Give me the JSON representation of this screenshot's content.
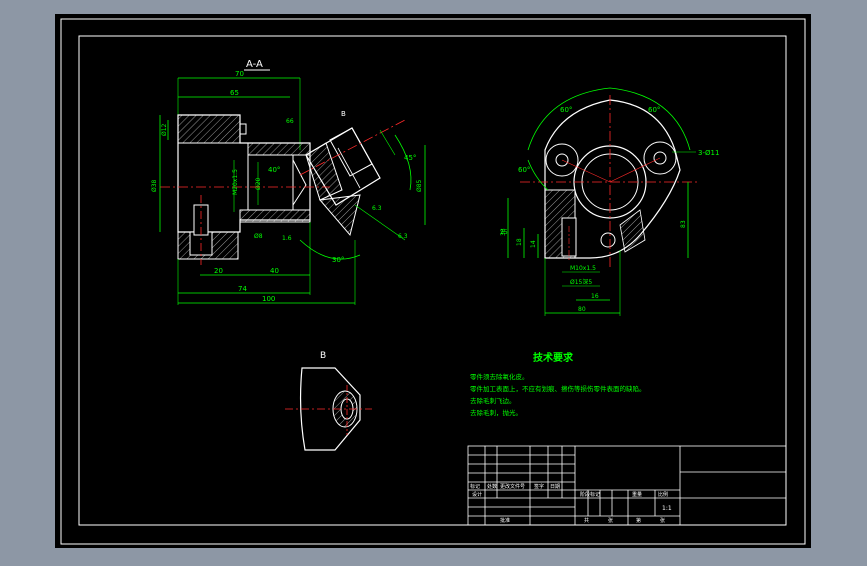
{
  "colors": {
    "frame_bg": "#8d97a5",
    "model_bg": "#000000",
    "outline": "#ffffff",
    "dimension": "#00ff00",
    "hatch": "#ffffff",
    "centerline": "#ff2a2a",
    "title_text": "#ffffff"
  },
  "section_label": "A-A",
  "detail_label": "B",
  "right_view_label_b": "B",
  "dimensions": {
    "top_overall": "70",
    "top_second": "65",
    "left_dia": "Ø38",
    "left_small": "Ø12",
    "bottom_20": "20",
    "bottom_40": "40",
    "bottom_74": "74",
    "bottom_100": "100",
    "bore_m": "M20x1.5",
    "bore_depth": "Ø20",
    "angle_40": "40°",
    "angle_30": "30°",
    "angle_45": "45°",
    "depth_66": "66",
    "right_dia": "Ø85",
    "chamfer_1": "1.6",
    "chamfer_2": "6.3",
    "right_view_angle_left": "60°",
    "right_view_angle_right": "60°",
    "right_view_angle_lower": "60°",
    "holes": "3-Ø11",
    "rv_height": "83",
    "rv_38": "38",
    "rv_18": "18",
    "rv_14": "14",
    "rv_m": "M10x1.5",
    "rv_16": "16",
    "rv_80": "80",
    "rv_counterbore": "Ø15深5",
    "rv_25": "25",
    "small_dim_a": "Ø8",
    "small_dim_b": "6.3"
  },
  "tech_req": {
    "title": "技术要求",
    "lines": [
      "零件须去除氧化皮。",
      "零件加工表面上，不应有划痕、擦伤等损伤零件表面的缺陷。",
      "去除毛刺飞边。",
      "去除毛刺，抛光。"
    ]
  },
  "title_block": {
    "row_labels": [
      "标记",
      "处数",
      "更改文件号",
      "签字",
      "日期"
    ],
    "design": "设计",
    "approve": "批准",
    "stage_labels": [
      "阶段标记",
      "重量",
      "比例"
    ],
    "scale": "1:1",
    "sheet_labels": [
      "共",
      "张",
      "第",
      "张"
    ]
  }
}
